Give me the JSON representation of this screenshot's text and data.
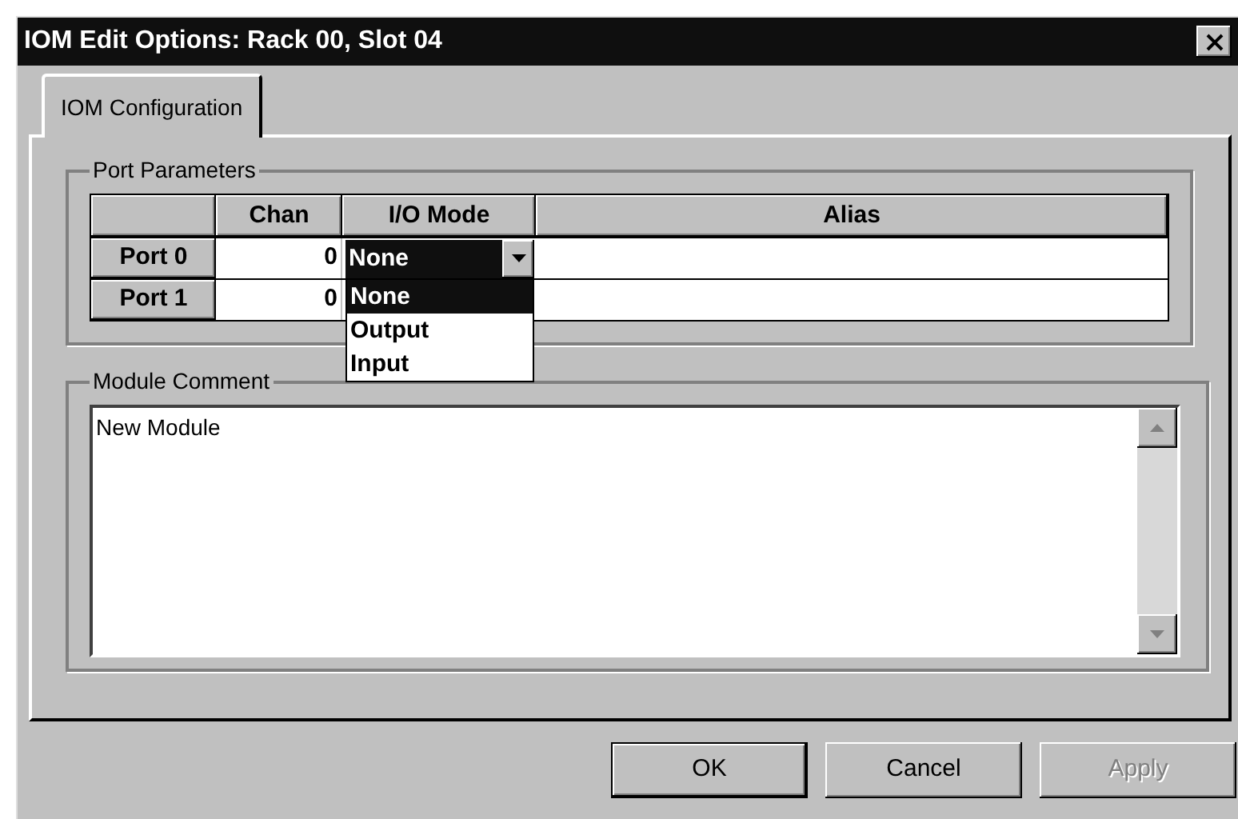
{
  "window": {
    "title": "IOM Edit Options: Rack 00, Slot 04"
  },
  "tabs": [
    {
      "label": "IOM Configuration",
      "selected": true
    }
  ],
  "port_parameters": {
    "title": "Port Parameters",
    "columns": [
      "Chan",
      "I/O Mode",
      "Alias"
    ],
    "rows": [
      {
        "port": "Port 0",
        "chan": "0",
        "io_mode": "None",
        "editing": true
      },
      {
        "port": "Port 1",
        "chan": "0",
        "editing": false
      }
    ],
    "dropdown": {
      "options": [
        {
          "label": "None",
          "selected": true
        },
        {
          "label": "Output",
          "selected": false
        },
        {
          "label": "Input",
          "selected": false
        }
      ]
    }
  },
  "module_comment": {
    "title": "Module Comment",
    "value": "New Module"
  },
  "buttons": [
    {
      "label": "OK",
      "default": true,
      "disabled": false
    },
    {
      "label": "Cancel",
      "default": false,
      "disabled": false
    },
    {
      "label": "Apply",
      "default": false,
      "disabled": true
    }
  ]
}
